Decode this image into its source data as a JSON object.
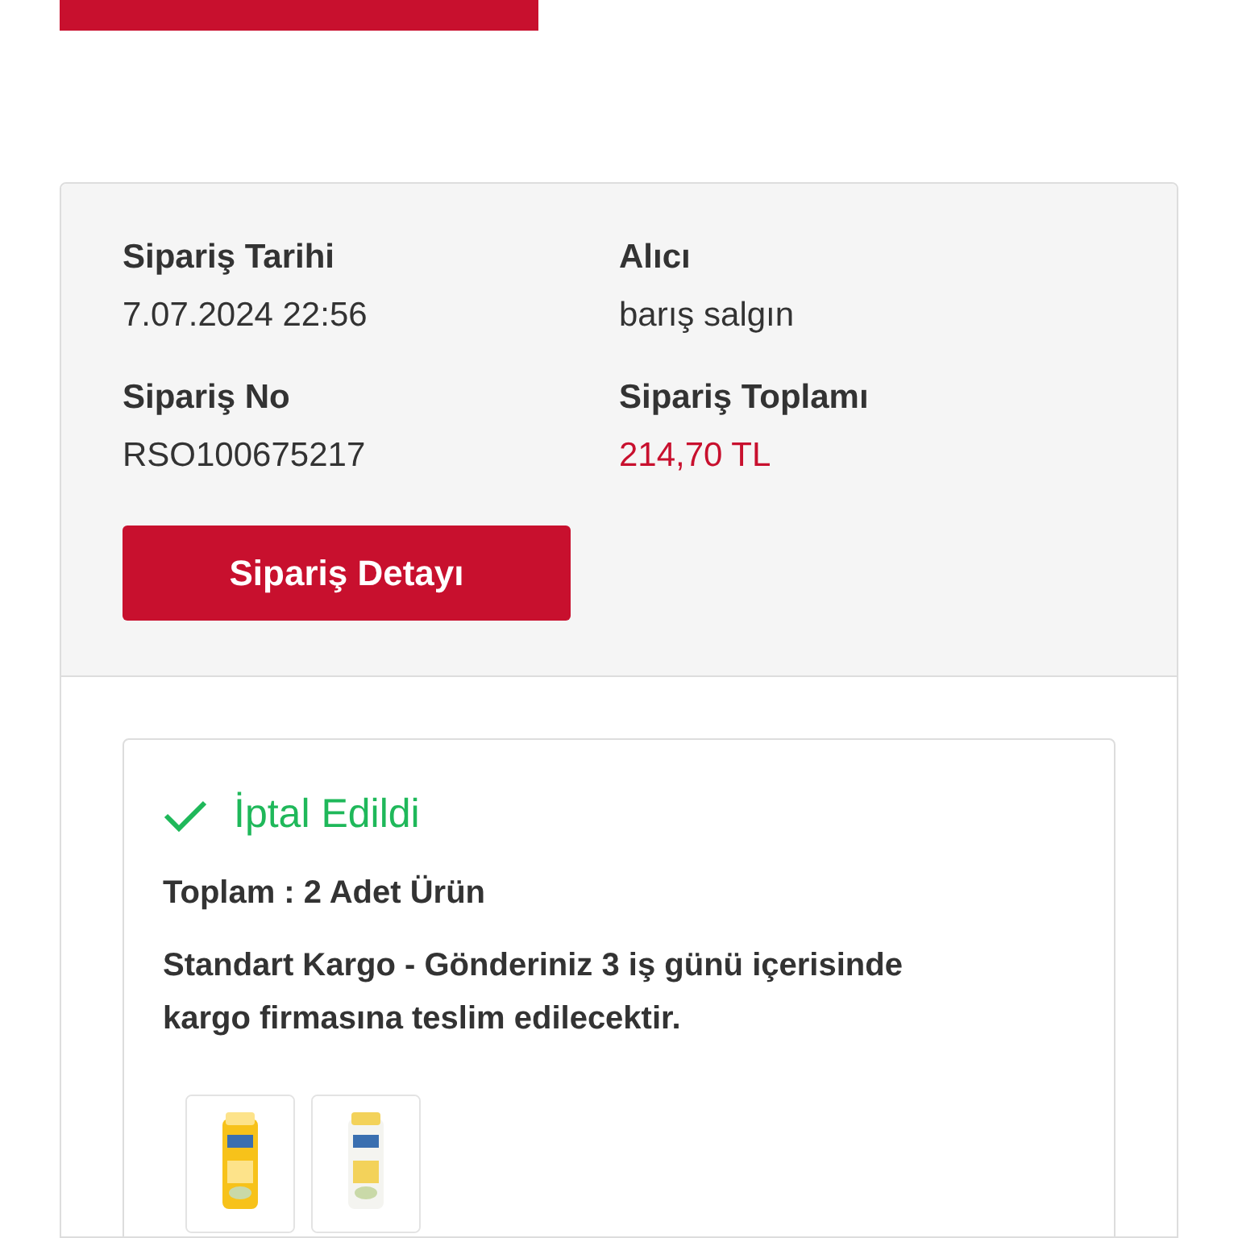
{
  "top_button": {
    "kind": "button"
  },
  "order": {
    "fields": [
      {
        "label": "Sipariş Tarihi",
        "value": "7.07.2024 22:56",
        "kind": "plain"
      },
      {
        "label": "Alıcı",
        "value": "barış salgın",
        "kind": "plain"
      },
      {
        "label": "Sipariş No",
        "value": "RSO100675217",
        "kind": "plain"
      },
      {
        "label": "Sipariş Toplamı",
        "value": "214,70 TL",
        "kind": "price"
      }
    ],
    "detail_button": "Sipariş Detayı"
  },
  "shipment": {
    "status": "İptal Edildi",
    "total": "Toplam : 2 Adet Ürün",
    "shipping": "Standart Kargo - Gönderiniz 3 iş günü içerisinde kargo firmasına teslim edilecektir."
  }
}
